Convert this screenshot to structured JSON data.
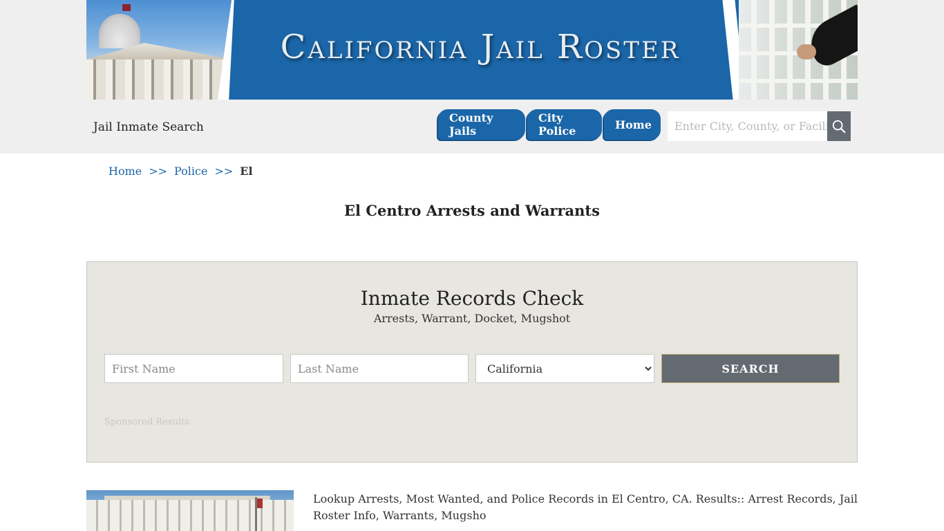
{
  "banner": {
    "title": "California Jail Roster"
  },
  "header": {
    "site_label": "Jail Inmate Search",
    "nav": {
      "county": "County Jails",
      "city": "City Police",
      "home": "Home"
    },
    "search": {
      "placeholder": "Enter City, County, or Facility"
    }
  },
  "breadcrumb": {
    "home": "Home",
    "sep": ">>",
    "police": "Police",
    "current": "El"
  },
  "page": {
    "title": "El Centro Arrests and Warrants"
  },
  "records": {
    "title": "Inmate Records Check",
    "subtitle": "Arrests, Warrant, Docket, Mugshot",
    "first_placeholder": "First Name",
    "last_placeholder": "Last Name",
    "state_selected": "California",
    "search_label": "SEARCH",
    "sponsored": "Sponsored Results"
  },
  "intro": {
    "text": "Lookup Arrests, Most Wanted, and Police Records in El Centro, CA. Results:: Arrest Records, Jail Roster Info, Warrants, Mugsho"
  },
  "icons": {
    "search": "search-icon"
  },
  "colors": {
    "brand_blue": "#1b66a8",
    "button_gray": "#646a72",
    "panel_bg": "#e8e6e1"
  }
}
